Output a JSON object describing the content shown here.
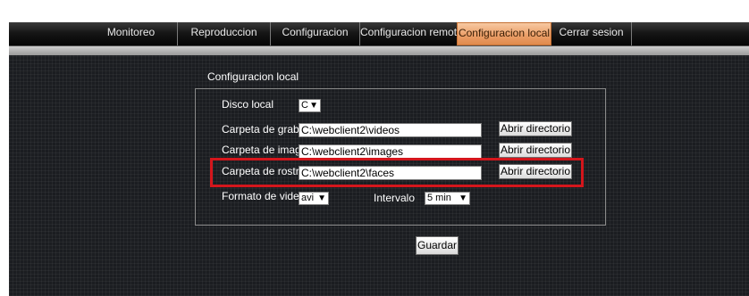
{
  "nav": {
    "tabs": [
      {
        "label": "Monitoreo"
      },
      {
        "label": "Reproduccion"
      },
      {
        "label": "Configuracion"
      },
      {
        "label": "Configuracion remota"
      },
      {
        "label": "Configuracion local",
        "active": true
      },
      {
        "label": "Cerrar sesion"
      }
    ]
  },
  "colors": {
    "active_tab": "#eca06a",
    "highlight": "#d4161c",
    "panel_bg": "#1b1d21"
  },
  "local_config": {
    "title": "Configuracion local",
    "disk": {
      "label": "Disco local",
      "value": "C"
    },
    "record_folder": {
      "label": "Carpeta de grab.",
      "value": "C:\\webclient2\\videos",
      "button": "Abrir directorio"
    },
    "image_folder": {
      "label": "Carpeta de imag.",
      "value": "C:\\webclient2\\images",
      "button": "Abrir directorio"
    },
    "faces_folder": {
      "label": "Carpeta de rostros",
      "value": "C:\\webclient2\\faces",
      "button": "Abrir directorio"
    },
    "video_format": {
      "label": "Formato de video",
      "value": "avi"
    },
    "interval": {
      "label": "Intervalo",
      "value": "5 min"
    },
    "save_label": "Guardar"
  },
  "icons": {
    "dropdown": "chevron-down-icon"
  }
}
